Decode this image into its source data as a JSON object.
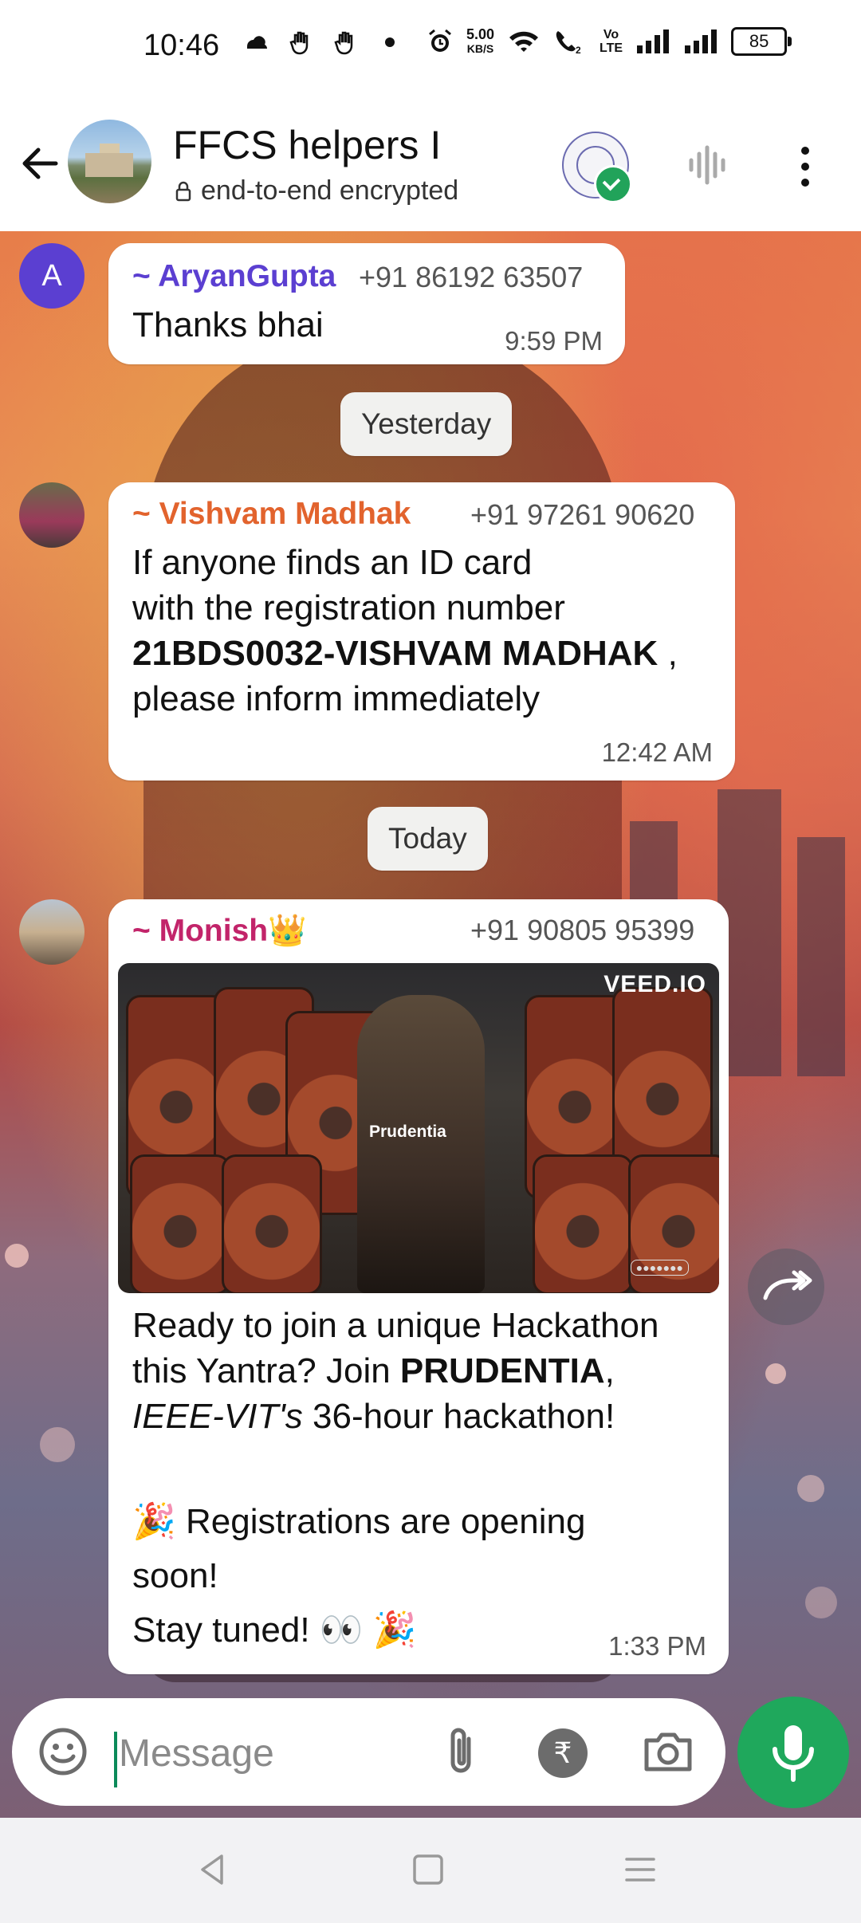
{
  "status_bar": {
    "time": "10:46",
    "net_speed_value": "5.00",
    "net_speed_unit": "KB/S",
    "volte": "Vo\nLTE",
    "battery": "85"
  },
  "header": {
    "title": "FFCS helpers I",
    "subtitle": "end-to-end encrypted"
  },
  "messages": [
    {
      "avatar_letter": "A",
      "sender": "~ AryanGupta",
      "sender_color": "#5b3fd1",
      "phone": "+91 86192 63507",
      "text": "Thanks bhai",
      "time": "9:59 PM"
    },
    {
      "sender": "~ Vishvam Madhak",
      "sender_color": "#e2632d",
      "phone": "+91 97261 90620",
      "text_line1": "If anyone finds an ID card",
      "text_line2": "with the registration number",
      "text_bold": "21BDS0032-VISHVAM MADHAK",
      "text_after_bold": " ,",
      "text_line4": "please inform immediately",
      "time": "12:42 AM"
    },
    {
      "sender": "~ Monish👑",
      "sender_color": "#c2246a",
      "phone": "+91 90805 95399",
      "video_watermark": "VEED.IO",
      "video_caption": "Prudentia",
      "line1": "Ready to join a unique Hackathon",
      "line2_pre": "this Yantra? Join ",
      "line2_bold": "PRUDENTIA",
      "line2_post": ",",
      "line3_italic": "IEEE-VIT's",
      "line3_post": " 36-hour hackathon!",
      "line4": "🎉 Registrations are opening",
      "line5": "soon!",
      "line6": "Stay tuned! 👀 🎉",
      "time": "1:33 PM"
    }
  ],
  "date_chips": {
    "yesterday": "Yesterday",
    "today": "Today"
  },
  "input": {
    "placeholder": "Message"
  },
  "colors": {
    "accent_green": "#1fa85c",
    "verified_green": "#21a35a"
  },
  "icons": [
    "back-arrow-icon",
    "lock-icon",
    "verified-icon",
    "audio-call-icon",
    "more-options-icon",
    "forward-icon",
    "emoji-icon",
    "attach-icon",
    "rupee-icon",
    "camera-icon",
    "mic-icon",
    "nav-back-icon",
    "nav-home-icon",
    "nav-recents-icon"
  ]
}
